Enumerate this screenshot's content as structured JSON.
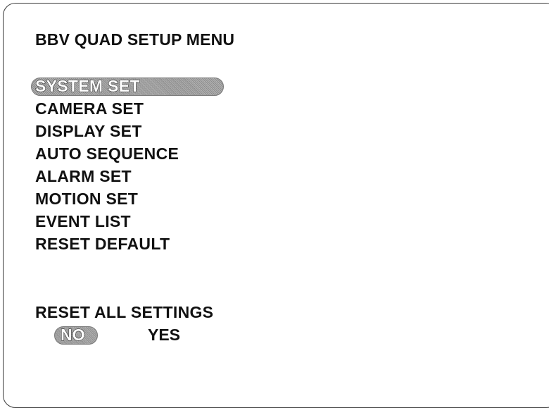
{
  "menu": {
    "title": "BBV QUAD SETUP MENU",
    "selected_index": 0,
    "items": [
      {
        "label": "SYSTEM SET"
      },
      {
        "label": "CAMERA SET"
      },
      {
        "label": "DISPLAY SET"
      },
      {
        "label": "AUTO SEQUENCE"
      },
      {
        "label": "ALARM SET"
      },
      {
        "label": "MOTION SET"
      },
      {
        "label": "EVENT LIST"
      },
      {
        "label": "RESET DEFAULT"
      }
    ]
  },
  "reset": {
    "title": "RESET ALL SETTINGS",
    "selected_option": "NO",
    "options": {
      "no": "NO",
      "yes": "YES"
    }
  },
  "colors": {
    "background": "#ffffff",
    "text": "#111111",
    "highlight": "#a0a0a0",
    "selected_text": "#ffffff"
  }
}
